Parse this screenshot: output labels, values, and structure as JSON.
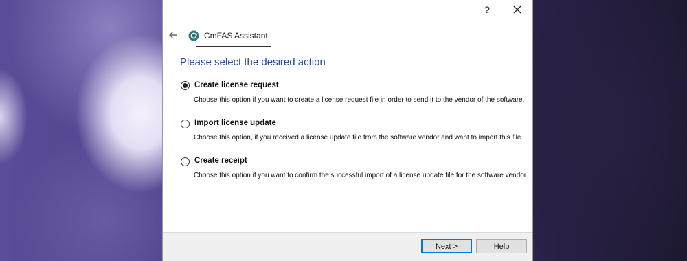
{
  "window": {
    "help_glyph": "?",
    "close_icon": "close-icon"
  },
  "header": {
    "back_icon": "back-arrow-icon",
    "app_icon": "cmfas-refresh-icon",
    "app_title": "CmFAS Assistant"
  },
  "main": {
    "heading": "Please select the desired action",
    "options": [
      {
        "label": "Create license request",
        "description": "Choose this option if you want to create a license request file in order to send it to the vendor of the software.",
        "selected": true
      },
      {
        "label": "Import license update",
        "description": "Choose this option, if you received a license update file from the software vendor and want to import this file.",
        "selected": false
      },
      {
        "label": "Create receipt",
        "description": "Choose this option if you want to confirm the successful import of a license update file for the software vendor.",
        "selected": false
      }
    ]
  },
  "footer": {
    "next_label": "Next >",
    "help_label": "Help"
  },
  "colors": {
    "heading": "#1f4fa0",
    "app_icon": "#2b7a78",
    "focus_border": "#0078d7"
  }
}
